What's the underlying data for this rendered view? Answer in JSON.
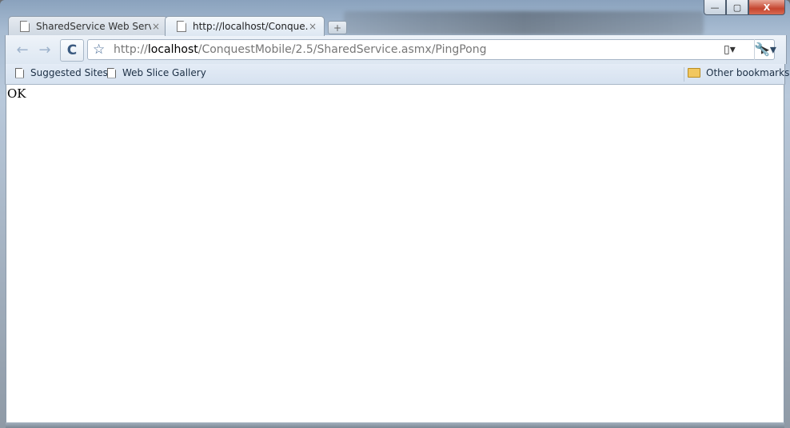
{
  "tabs": [
    {
      "title": "SharedService Web Service",
      "close": "×"
    },
    {
      "title": "http://localhost/Conque...",
      "close": "×"
    }
  ],
  "toolbar": {
    "back_icon": "←",
    "forward_icon": "→",
    "reload_icon": "C",
    "star_icon": "☆",
    "url_scheme": "http://",
    "url_host": "localhost",
    "url_path": "/ConquestMobile/2.5/SharedService.asmx/PingPong",
    "go_icon": "▶",
    "page_menu_icon": "▯▾",
    "wrench_icon": "🔧▾"
  },
  "bookmarks": {
    "items": [
      {
        "label": "Suggested Sites"
      },
      {
        "label": "Web Slice Gallery"
      }
    ],
    "other": "Other bookmarks"
  },
  "window": {
    "minimize": "—",
    "maximize": "▢",
    "close": "X"
  },
  "content": {
    "text": "OK"
  }
}
